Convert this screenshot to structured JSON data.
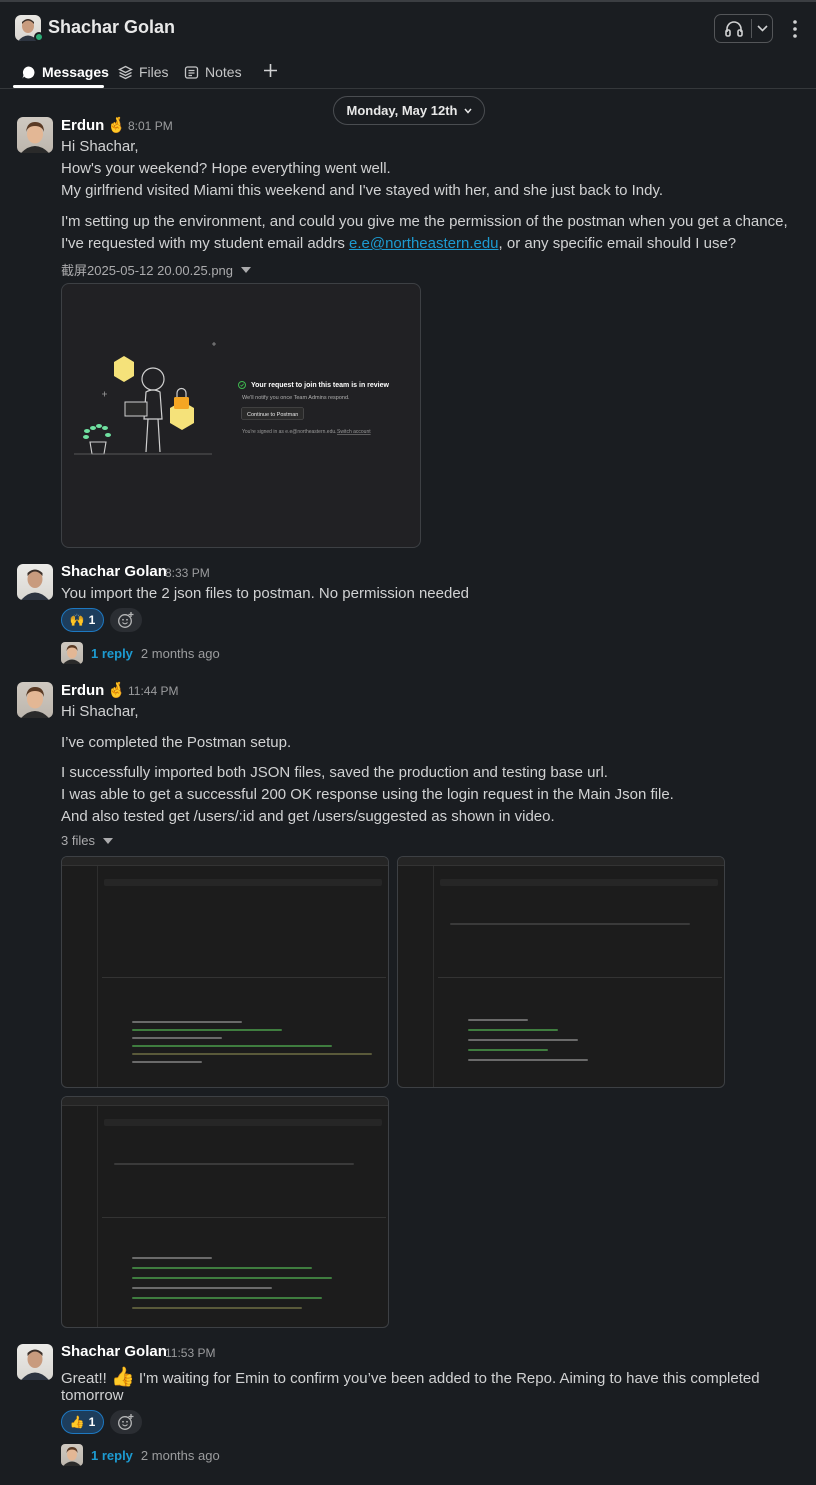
{
  "header": {
    "title": "Shachar Golan",
    "presence": "online"
  },
  "tabs": [
    {
      "label": "Messages",
      "icon": "chat-bubble-icon",
      "active": true
    },
    {
      "label": "Files",
      "icon": "layers-icon",
      "active": false
    },
    {
      "label": "Notes",
      "icon": "notes-icon",
      "active": false
    }
  ],
  "date_divider": "Monday, May 12th",
  "messages": [
    {
      "author": "Erdun",
      "author_emoji": "🤞",
      "time": "8:01 PM",
      "lines": [
        "Hi Shachar,",
        "How's your weekend? Hope everything went well.",
        "My girlfriend visited Miami this weekend and I've stayed with her, and she just back to Indy.",
        "I'm setting up the environment, and could you give me the permission of the postman when you get a chance,",
        "I've requested with my student email addrs ",
        ", or any specific email should I use?"
      ],
      "email_link": "e.e@northeastern.edu",
      "attachment_name": "截屏2025-05-12 20.00.25.png",
      "attachment_preview": {
        "title": "Your request to join this team is in review",
        "subtitle": "We'll notify you once Team Admins respond.",
        "button": "Continue to Postman",
        "footer": "You're signed in as e.e@northeastern.edu.",
        "footer_link": "Switch account"
      }
    },
    {
      "author": "Shachar Golan",
      "time": "8:33 PM",
      "lines": [
        "You import the 2 json files to postman. No permission needed"
      ],
      "reaction": {
        "emoji": "🙌",
        "count": "1"
      },
      "thread": {
        "replies": "1 reply",
        "ago": "2 months ago"
      }
    },
    {
      "author": "Erdun",
      "author_emoji": "🤞",
      "time": "11:44 PM",
      "lines": [
        "Hi Shachar,",
        "I’ve completed the Postman setup.",
        "I successfully imported both JSON files, saved the production and testing base url.",
        "I was able to get a successful 200 OK response using the login request in the Main Json file.",
        "And also tested get /users/:id and get /users/suggested as shown in video."
      ],
      "files_label": "3 files"
    },
    {
      "author": "Shachar Golan",
      "time": "11:53 PM",
      "text_before_emoji": "Great!! ",
      "inline_emoji": "👍",
      "lines": [
        " I'm waiting for Emin to confirm you’ve been added to the Repo. Aiming to have this completed",
        "tomorrow"
      ],
      "reaction": {
        "emoji": "👍",
        "count": "1"
      },
      "thread": {
        "replies": "1 reply",
        "ago": "2 months ago"
      }
    }
  ],
  "colors": {
    "background": "#1a1d21",
    "link": "#1d9bd1",
    "reaction_bg": "#1d3d5c",
    "reaction_border": "#1d78c1",
    "presence": "#2bac76",
    "illustration_yellow": "#f5e27a",
    "illustration_orange": "#f5a623",
    "postman_green": "#3fb950"
  }
}
